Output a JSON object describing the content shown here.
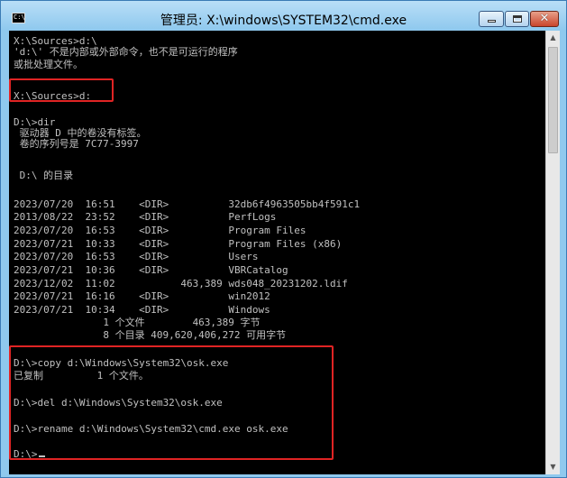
{
  "window": {
    "title": "管理员: X:\\windows\\SYSTEM32\\cmd.exe",
    "icon_text": "C:\\",
    "controls": {
      "minimize": "minimize-icon",
      "maximize": "maximize-icon",
      "close": "✕"
    }
  },
  "console": {
    "lines": [
      "X:\\Sources>d:\\",
      "'d:\\' 不是内部或外部命令，也不是可运行的程序",
      "或批处理文件。",
      "",
      "X:\\Sources>d:",
      "",
      "D:\\>dir",
      " 驱动器 D 中的卷没有标签。",
      " 卷的序列号是 7C77-3997",
      "",
      " D:\\ 的目录",
      "",
      "2023/07/20  16:51    <DIR>          32db6f4963505bb4f591c1",
      "2013/08/22  23:52    <DIR>          PerfLogs",
      "2023/07/20  16:53    <DIR>          Program Files",
      "2023/07/21  10:33    <DIR>          Program Files (x86)",
      "2023/07/20  16:53    <DIR>          Users",
      "2023/07/21  10:36    <DIR>          VBRCatalog",
      "2023/12/02  11:02           463,389 wds048_20231202.ldif",
      "2023/07/21  16:16    <DIR>          win2012",
      "2023/07/21  10:34    <DIR>          Windows",
      "               1 个文件        463,389 字节",
      "               8 个目录 409,620,406,272 可用字节",
      "",
      "D:\\>copy d:\\Windows\\System32\\osk.exe",
      "已复制         1 个文件。",
      "",
      "D:\\>del d:\\Windows\\System32\\osk.exe",
      "",
      "D:\\>rename d:\\Windows\\System32\\cmd.exe osk.exe",
      "",
      "D:\\>"
    ]
  },
  "colors": {
    "highlight": "#e02424",
    "console_bg": "#000000",
    "console_fg": "#c0c0c0"
  }
}
